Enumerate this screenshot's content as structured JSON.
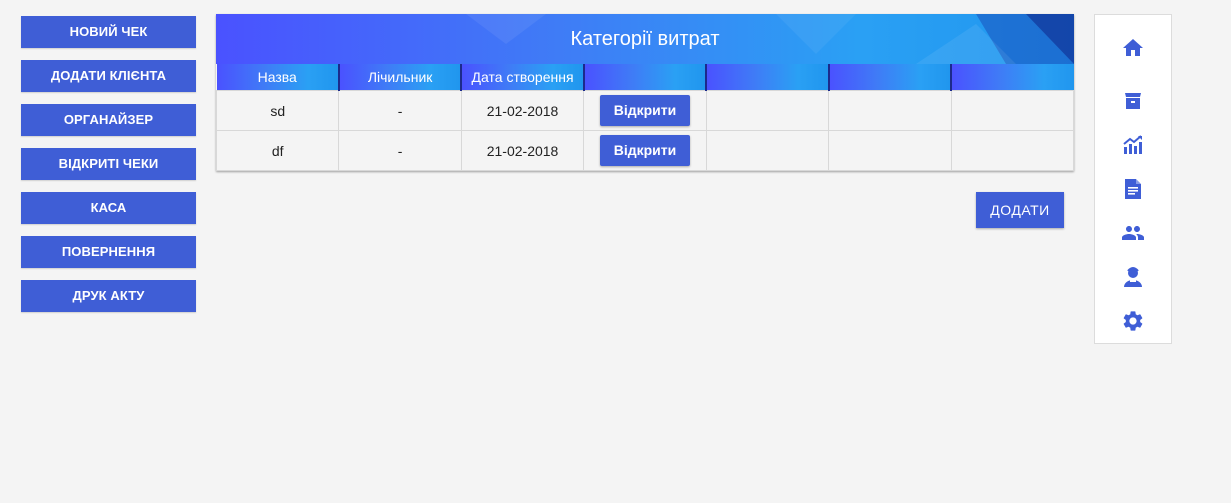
{
  "colors": {
    "primary": "#3f5ed6",
    "header_gradient_start": "#4a52ff",
    "header_gradient_end": "#2096ee",
    "background": "#f4f4f4"
  },
  "left_menu": [
    {
      "label": "НОВИЙ ЧЕК"
    },
    {
      "label": "ДОДАТИ КЛІЄНТА"
    },
    {
      "label": "ОРГАНАЙЗЕР"
    },
    {
      "label": "ВІДКРИТІ ЧЕКИ"
    },
    {
      "label": "КАСА"
    },
    {
      "label": "ПОВЕРНЕННЯ"
    },
    {
      "label": "ДРУК АКТУ"
    }
  ],
  "panel": {
    "title": "Категорії витрат",
    "columns": [
      "Назва",
      "Лічильник",
      "Дата створення",
      "",
      "",
      "",
      ""
    ],
    "rows": [
      {
        "name": "sd",
        "counter": "-",
        "created": "21-02-2018",
        "action": "Відкрити"
      },
      {
        "name": "df",
        "counter": "-",
        "created": "21-02-2018",
        "action": "Відкрити"
      }
    ]
  },
  "add_button": {
    "label": "ДОДАТИ"
  },
  "right_bar": {
    "icons": [
      "home-icon",
      "archive-box-icon",
      "trending-chart-icon",
      "document-icon",
      "people-icon",
      "user-support-icon",
      "settings-gear-icon"
    ]
  }
}
